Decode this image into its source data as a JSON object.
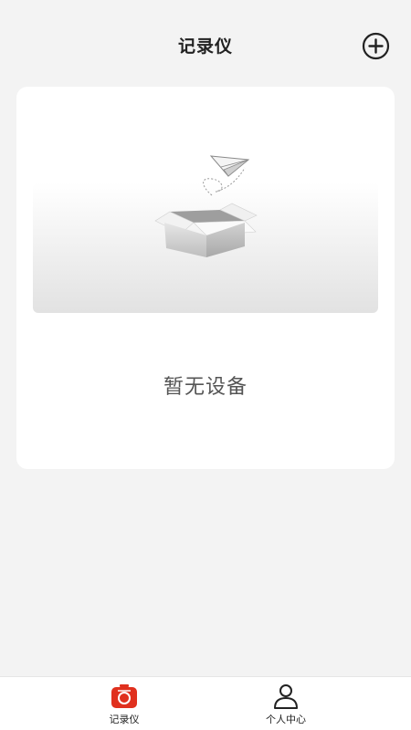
{
  "header": {
    "title": "记录仪"
  },
  "icons": {
    "add": "plus-circle-icon",
    "empty": "empty-box-paper-plane-illustration",
    "recorder_tab": "camera-recorder-icon",
    "profile_tab": "person-icon"
  },
  "empty_state": {
    "message": "暂无设备"
  },
  "tabbar": {
    "items": [
      {
        "label": "记录仪",
        "active": true
      },
      {
        "label": "个人中心",
        "active": false
      }
    ]
  },
  "colors": {
    "accent": "#e0301e",
    "background": "#f3f3f3",
    "card": "#ffffff",
    "text_dark": "#222222",
    "text_muted": "#555555"
  }
}
